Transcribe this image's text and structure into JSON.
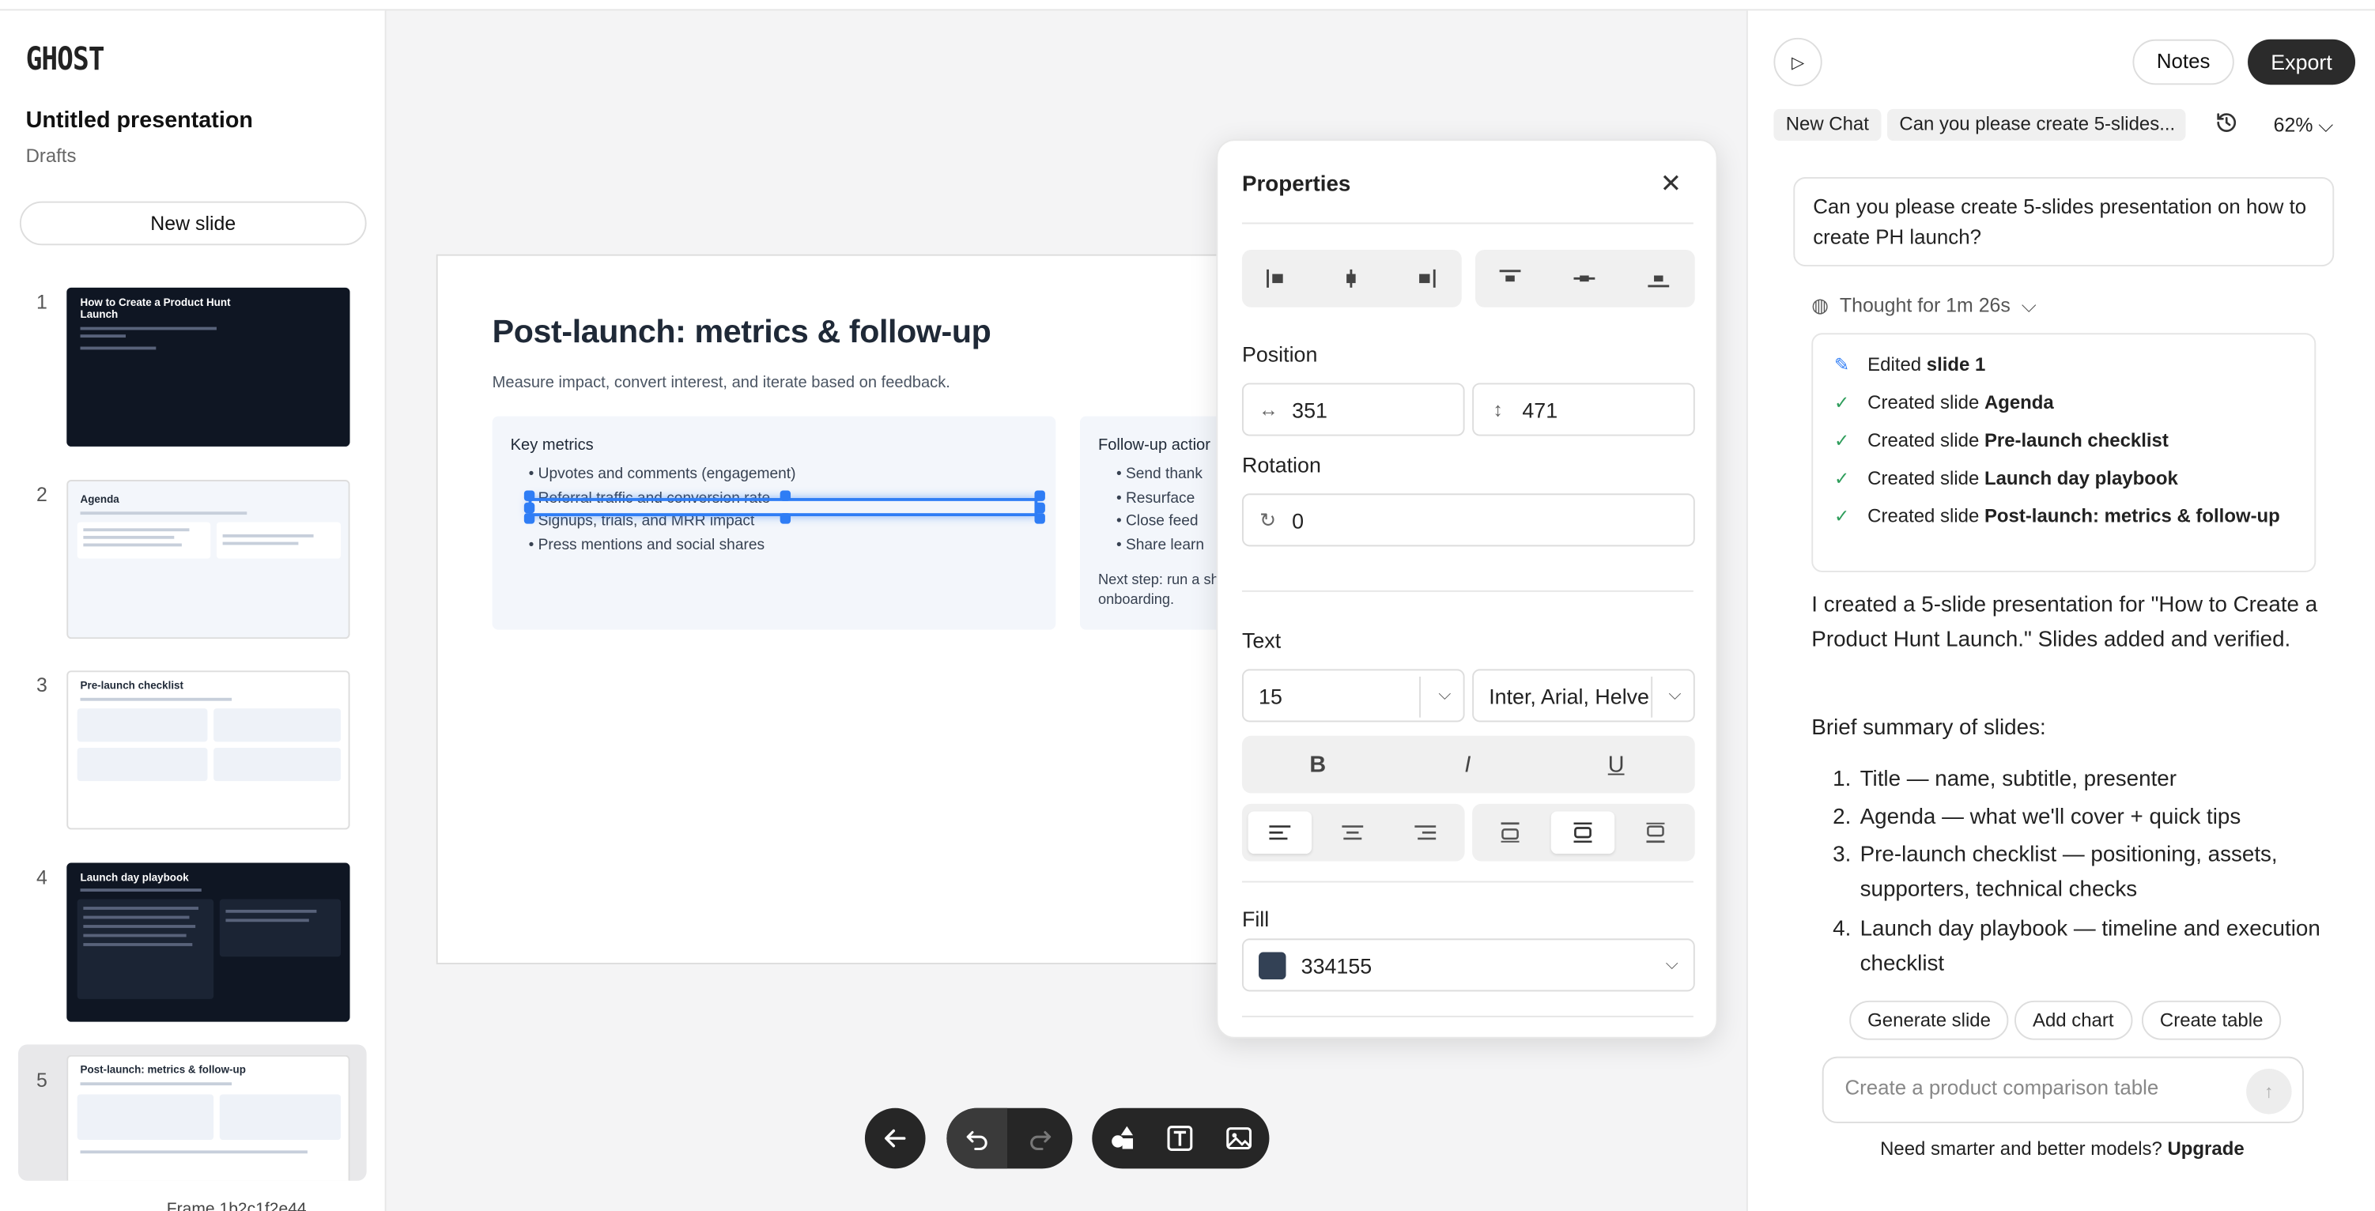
{
  "app": {
    "logo": "GHOST"
  },
  "sidebar": {
    "title": "Untitled presentation",
    "subtitle": "Drafts",
    "new_slide_label": "New slide",
    "slides": [
      {
        "num": "1",
        "title": "How to Create a Product Hunt Launch"
      },
      {
        "num": "2",
        "title": "Agenda"
      },
      {
        "num": "3",
        "title": "Pre-launch checklist"
      },
      {
        "num": "4",
        "title": "Launch day playbook"
      },
      {
        "num": "5",
        "title": "Post-launch: metrics & follow-up"
      }
    ]
  },
  "slide": {
    "title": "Post-launch: metrics & follow-up",
    "subtitle": "Measure impact, convert interest, and iterate based on feedback.",
    "card1": {
      "heading": "Key metrics",
      "bullets": [
        "• Upvotes and comments (engagement)",
        "• Referral traffic and conversion rate",
        "• Signups, trials, and MRR impact",
        "• Press mentions and social shares"
      ]
    },
    "card2": {
      "heading": "Follow-up actior",
      "bullets": [
        "• Send thank",
        "• Resurface",
        "• Close feed",
        "• Share learn"
      ],
      "next_step": "Next step: run a sh onboarding."
    }
  },
  "properties": {
    "title": "Properties",
    "position_label": "Position",
    "position_x": "351",
    "position_y": "471",
    "rotation_label": "Rotation",
    "rotation_value": "0",
    "text_label": "Text",
    "font_size": "15",
    "font_family": "Inter, Arial, Helve",
    "bold": "B",
    "italic": "I",
    "underline": "U",
    "fill_label": "Fill",
    "fill_value": "334155",
    "fill_color": "#334155"
  },
  "chat": {
    "notes_label": "Notes",
    "export_label": "Export",
    "new_chat_label": "New Chat",
    "chat_tab": "Can you please create 5-slides...",
    "zoom": "62%",
    "user_message": "Can you please create 5-slides presentation on how to create PH launch?",
    "thought": "Thought for 1m 26s",
    "steps": [
      {
        "prefix": "Edited ",
        "bold": "slide 1"
      },
      {
        "prefix": "Created slide ",
        "bold": "Agenda"
      },
      {
        "prefix": "Created slide ",
        "bold": "Pre-launch checklist"
      },
      {
        "prefix": "Created slide ",
        "bold": "Launch day playbook"
      },
      {
        "prefix": "Created slide ",
        "bold": "Post-launch: metrics & follow-up"
      }
    ],
    "response_intro": "I created a 5-slide presentation for \"How to Create a Product Hunt Launch.\" Slides added and verified.",
    "summary_heading": "Brief summary of slides:",
    "summary": [
      {
        "n": "1.",
        "text": "Title — name, subtitle, presenter"
      },
      {
        "n": "2.",
        "text": "Agenda — what we'll cover + quick tips"
      },
      {
        "n": "3.",
        "text": "Pre-launch checklist — positioning, assets, supporters, technical checks"
      },
      {
        "n": "4.",
        "text": "Launch day playbook — timeline and execution checklist"
      }
    ],
    "suggestions": [
      "Generate slide",
      "Add chart",
      "Create table"
    ],
    "input_placeholder": "Create a product comparison table",
    "upsell_text": "Need smarter and better models?",
    "upsell_link": "Upgrade"
  },
  "footer_clip": "Frame 1b2c1f2e44"
}
